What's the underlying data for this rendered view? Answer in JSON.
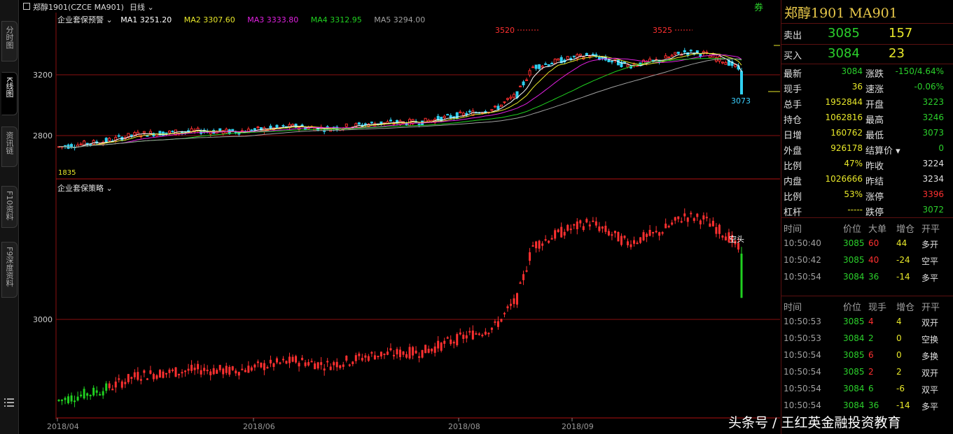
{
  "symbol_header": "郑醇1901(CZCE MA901)",
  "period": "日线",
  "period_chevron": "chevron-down-icon",
  "top_right_link": "券",
  "main_indicator": {
    "name": "企业套保预警",
    "ma1": "MA1  3251.20",
    "ma2": "MA2  3307.60",
    "ma3": "MA3  3333.80",
    "ma4": "MA4  3312.95",
    "ma5": "MA5  3294.00"
  },
  "colors": {
    "ma1": "#ffffff",
    "ma2": "#e8e82a",
    "ma3": "#e020e0",
    "ma4": "#20d020",
    "ma5": "#a0a0a0",
    "up": "#ff3030",
    "down": "#30d0f0",
    "grid": "#8a1010"
  },
  "upper_axis": {
    "labels": [
      "3200",
      "2800"
    ]
  },
  "upper_marks": {
    "high1": "3520",
    "high2": "3525",
    "last": "3073",
    "low": "1835"
  },
  "lower_indicator": {
    "name": "企业套保策略",
    "signal": "空头"
  },
  "lower_axis": {
    "labels": [
      "3000"
    ]
  },
  "x_axis": {
    "labels": [
      "2018/04",
      "2018/06",
      "2018/08",
      "2018/09"
    ]
  },
  "left_tabs": [
    "分时图",
    "K线图",
    "资讯链",
    "F10资料",
    "F9深度资料"
  ],
  "quote": {
    "title": "郑醇1901  MA901",
    "sell": {
      "label": "卖出",
      "price": "3085",
      "vol": "157"
    },
    "buy": {
      "label": "买入",
      "price": "3084",
      "vol": "23"
    },
    "stats": [
      {
        "l1": "最新",
        "v1": "3084",
        "l2": "涨跌",
        "v2": "-150/4.64%"
      },
      {
        "l1": "现手",
        "v1": "36",
        "l2": "速涨",
        "v2": "-0.06%"
      },
      {
        "l1": "总手",
        "v1": "1952844",
        "l2": "开盘",
        "v2": "3223"
      },
      {
        "l1": "持仓",
        "v1": "1062816",
        "l2": "最高",
        "v2": "3246"
      },
      {
        "l1": "日增",
        "v1": "160762",
        "l2": "最低",
        "v2": "3073"
      },
      {
        "l1": "外盘",
        "v1": "926178",
        "l2": "结算价",
        "v2": "0"
      },
      {
        "l1": "比例",
        "v1": "47%",
        "l2": "昨收",
        "v2": "3224"
      },
      {
        "l1": "内盘",
        "v1": "1026666",
        "l2": "昨结",
        "v2": "3234"
      },
      {
        "l1": "比例",
        "v1": "53%",
        "l2": "涨停",
        "v2": "3396"
      },
      {
        "l1": "杠杆",
        "v1": "-----",
        "l2": "跌停",
        "v2": "3072"
      }
    ]
  },
  "tick1": {
    "headers": [
      "时间",
      "价位",
      "大单",
      "增仓",
      "开平"
    ],
    "rows": [
      [
        "10:50:40",
        "3085",
        "60",
        "44",
        "多开"
      ],
      [
        "10:50:42",
        "3085",
        "40",
        "-24",
        "空平"
      ],
      [
        "10:50:54",
        "3084",
        "36",
        "-14",
        "多平"
      ]
    ]
  },
  "tick2": {
    "headers": [
      "时间",
      "价位",
      "现手",
      "增仓",
      "开平"
    ],
    "rows": [
      [
        "10:50:53",
        "3085",
        "4",
        "4",
        "双开"
      ],
      [
        "10:50:53",
        "3084",
        "2",
        "0",
        "空换"
      ],
      [
        "10:50:54",
        "3085",
        "6",
        "0",
        "多换"
      ],
      [
        "10:50:54",
        "3085",
        "2",
        "2",
        "双开"
      ],
      [
        "10:50:54",
        "3084",
        "6",
        "-6",
        "双平"
      ],
      [
        "10:50:54",
        "3084",
        "36",
        "-14",
        "多平"
      ]
    ]
  },
  "watermark": "头条号 / 王红英金融投资教育"
}
